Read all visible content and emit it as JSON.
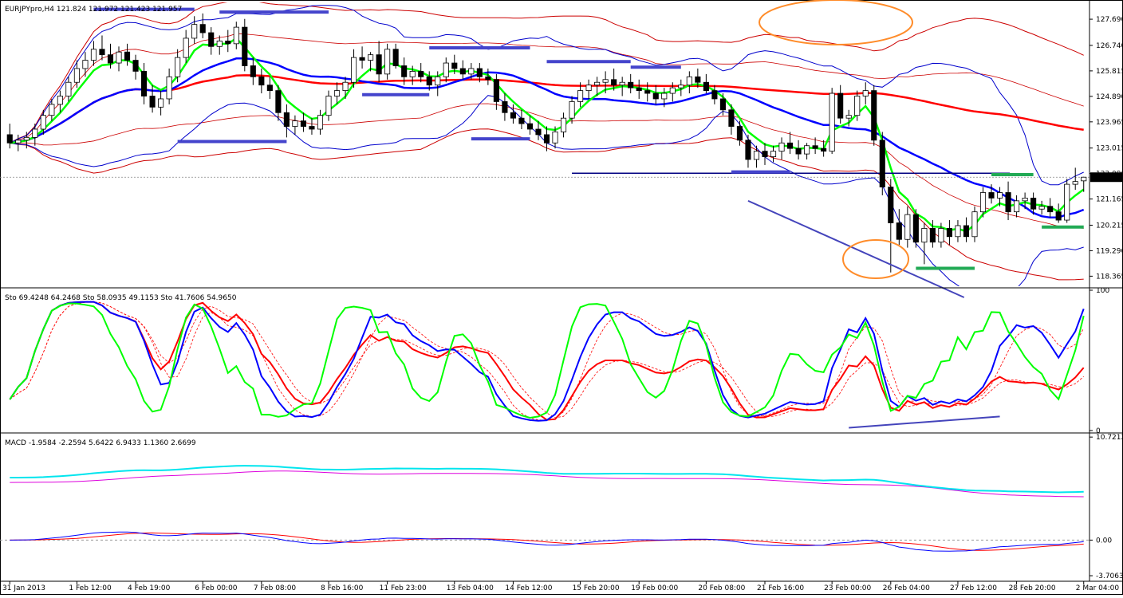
{
  "chart_data": [
    {
      "type": "candlestick",
      "panel": "price",
      "title": "EURJPYpro,H4  121.824 121.972 121.423 121.957",
      "y_ticks": [
        "127.690",
        "126.740",
        "125.815",
        "124.890",
        "123.965",
        "123.015",
        "122.090",
        "121.165",
        "120.215",
        "119.290",
        "118.365"
      ],
      "y_range": [
        118.0,
        128.3
      ],
      "current_price_label": "121.957",
      "horizontal_line_level": 122.1,
      "candles_ohlc": [
        [
          123.5,
          123.9,
          123.0,
          123.2
        ],
        [
          123.2,
          123.5,
          122.9,
          123.3
        ],
        [
          123.3,
          123.6,
          123.0,
          123.4
        ],
        [
          123.4,
          123.9,
          123.1,
          123.7
        ],
        [
          123.7,
          124.4,
          123.5,
          124.2
        ],
        [
          124.2,
          124.8,
          124.0,
          124.6
        ],
        [
          124.6,
          125.1,
          124.3,
          124.9
        ],
        [
          124.9,
          125.6,
          124.7,
          125.4
        ],
        [
          125.4,
          126.2,
          125.2,
          125.9
        ],
        [
          125.9,
          126.5,
          125.6,
          126.2
        ],
        [
          126.2,
          126.9,
          126.0,
          126.6
        ],
        [
          126.6,
          127.1,
          126.2,
          126.4
        ],
        [
          126.4,
          126.8,
          125.9,
          126.1
        ],
        [
          126.1,
          126.7,
          125.8,
          126.5
        ],
        [
          126.5,
          126.8,
          126.0,
          126.2
        ],
        [
          126.2,
          126.4,
          125.5,
          125.8
        ],
        [
          125.8,
          126.1,
          124.6,
          124.9
        ],
        [
          124.9,
          125.3,
          124.3,
          124.5
        ],
        [
          124.5,
          125.1,
          124.2,
          124.8
        ],
        [
          124.8,
          125.9,
          124.6,
          125.6
        ],
        [
          125.6,
          126.6,
          125.4,
          126.3
        ],
        [
          126.3,
          127.3,
          126.1,
          127.0
        ],
        [
          127.0,
          127.8,
          126.8,
          127.5
        ],
        [
          127.5,
          127.9,
          127.0,
          127.2
        ],
        [
          127.2,
          127.4,
          126.4,
          126.7
        ],
        [
          126.7,
          127.1,
          126.4,
          126.9
        ],
        [
          126.9,
          127.3,
          126.5,
          126.8
        ],
        [
          126.8,
          127.6,
          126.6,
          127.4
        ],
        [
          127.4,
          127.7,
          125.8,
          126.0
        ],
        [
          126.0,
          126.3,
          125.3,
          125.6
        ],
        [
          125.6,
          125.9,
          125.0,
          125.3
        ],
        [
          125.3,
          125.6,
          124.8,
          125.1
        ],
        [
          125.1,
          125.3,
          124.0,
          124.3
        ],
        [
          124.3,
          124.6,
          123.4,
          123.8
        ],
        [
          123.8,
          124.2,
          123.5,
          124.0
        ],
        [
          124.0,
          124.3,
          123.6,
          123.8
        ],
        [
          123.8,
          124.1,
          123.5,
          123.7
        ],
        [
          123.7,
          124.4,
          123.5,
          124.2
        ],
        [
          124.2,
          125.1,
          124.0,
          124.9
        ],
        [
          124.9,
          125.4,
          124.6,
          125.1
        ],
        [
          125.1,
          125.6,
          124.8,
          125.4
        ],
        [
          125.4,
          126.6,
          125.2,
          126.3
        ],
        [
          126.3,
          126.7,
          125.9,
          126.2
        ],
        [
          126.2,
          126.5,
          125.8,
          126.4
        ],
        [
          126.4,
          126.9,
          125.4,
          125.7
        ],
        [
          125.7,
          126.8,
          125.5,
          126.6
        ],
        [
          126.6,
          126.8,
          125.9,
          126.0
        ],
        [
          126.0,
          126.3,
          125.3,
          125.6
        ],
        [
          125.6,
          126.0,
          125.3,
          125.8
        ],
        [
          125.8,
          126.1,
          125.4,
          125.6
        ],
        [
          125.6,
          125.8,
          125.1,
          125.3
        ],
        [
          125.3,
          125.8,
          124.9,
          125.6
        ],
        [
          125.6,
          126.3,
          125.4,
          126.1
        ],
        [
          126.1,
          126.4,
          125.7,
          125.9
        ],
        [
          125.9,
          126.2,
          125.5,
          125.7
        ],
        [
          125.7,
          126.1,
          125.5,
          125.9
        ],
        [
          125.9,
          126.1,
          125.4,
          125.6
        ],
        [
          125.6,
          125.9,
          125.3,
          125.5
        ],
        [
          125.5,
          125.7,
          124.4,
          124.7
        ],
        [
          124.7,
          125.0,
          124.0,
          124.3
        ],
        [
          124.3,
          124.6,
          123.9,
          124.1
        ],
        [
          124.1,
          124.4,
          123.7,
          123.9
        ],
        [
          123.9,
          124.2,
          123.5,
          123.7
        ],
        [
          123.7,
          124.0,
          123.3,
          123.5
        ],
        [
          123.5,
          123.8,
          122.9,
          123.2
        ],
        [
          123.2,
          123.8,
          123.0,
          123.6
        ],
        [
          123.6,
          124.3,
          123.4,
          124.1
        ],
        [
          124.1,
          124.9,
          123.9,
          124.7
        ],
        [
          124.7,
          125.4,
          124.5,
          125.1
        ],
        [
          125.1,
          125.5,
          124.8,
          125.3
        ],
        [
          125.3,
          125.6,
          124.9,
          125.4
        ],
        [
          125.4,
          125.8,
          125.0,
          125.5
        ],
        [
          125.5,
          125.9,
          125.1,
          125.3
        ],
        [
          125.3,
          125.6,
          124.9,
          125.4
        ],
        [
          125.4,
          125.7,
          125.0,
          125.2
        ],
        [
          125.2,
          125.5,
          124.8,
          125.1
        ],
        [
          125.1,
          125.4,
          124.7,
          125.0
        ],
        [
          125.0,
          125.3,
          124.6,
          124.8
        ],
        [
          124.8,
          125.2,
          124.5,
          125.0
        ],
        [
          125.0,
          125.4,
          124.7,
          125.2
        ],
        [
          125.2,
          125.5,
          124.9,
          125.3
        ],
        [
          125.3,
          125.8,
          125.0,
          125.6
        ],
        [
          125.6,
          125.9,
          125.2,
          125.4
        ],
        [
          125.4,
          125.7,
          125.0,
          125.1
        ],
        [
          125.1,
          125.3,
          124.6,
          124.8
        ],
        [
          124.8,
          125.0,
          124.2,
          124.4
        ],
        [
          124.4,
          124.6,
          123.5,
          123.8
        ],
        [
          123.8,
          124.0,
          123.1,
          123.3
        ],
        [
          123.3,
          123.5,
          122.3,
          122.6
        ],
        [
          122.6,
          123.1,
          122.3,
          122.9
        ],
        [
          122.9,
          123.2,
          122.4,
          122.7
        ],
        [
          122.7,
          123.1,
          122.5,
          122.9
        ],
        [
          122.9,
          123.4,
          122.6,
          123.2
        ],
        [
          123.2,
          123.6,
          122.8,
          123.0
        ],
        [
          123.0,
          123.3,
          122.6,
          122.8
        ],
        [
          122.8,
          123.2,
          122.6,
          123.1
        ],
        [
          123.1,
          123.4,
          122.8,
          123.0
        ],
        [
          123.0,
          123.3,
          122.7,
          122.9
        ],
        [
          122.9,
          125.2,
          122.8,
          125.0
        ],
        [
          125.0,
          125.3,
          123.9,
          124.1
        ],
        [
          124.1,
          124.4,
          123.8,
          124.2
        ],
        [
          124.2,
          125.1,
          124.0,
          124.9
        ],
        [
          124.9,
          125.4,
          124.6,
          125.1
        ],
        [
          125.1,
          125.3,
          123.1,
          123.3
        ],
        [
          123.3,
          123.6,
          121.3,
          121.6
        ],
        [
          121.6,
          121.9,
          118.5,
          120.3
        ],
        [
          120.3,
          120.8,
          119.5,
          119.7
        ],
        [
          119.7,
          120.9,
          119.4,
          120.6
        ],
        [
          120.6,
          120.8,
          119.4,
          119.6
        ],
        [
          119.6,
          120.3,
          118.8,
          120.1
        ],
        [
          120.1,
          120.4,
          119.4,
          119.6
        ],
        [
          119.6,
          120.3,
          119.4,
          120.1
        ],
        [
          120.1,
          120.4,
          119.5,
          119.8
        ],
        [
          119.8,
          120.4,
          119.6,
          120.2
        ],
        [
          120.2,
          120.5,
          119.6,
          119.8
        ],
        [
          119.8,
          120.9,
          119.6,
          120.7
        ],
        [
          120.7,
          121.6,
          120.5,
          121.4
        ],
        [
          121.4,
          121.7,
          121.0,
          121.2
        ],
        [
          121.2,
          121.6,
          120.9,
          121.4
        ],
        [
          121.4,
          121.8,
          120.4,
          120.7
        ],
        [
          120.7,
          121.3,
          120.5,
          121.1
        ],
        [
          121.1,
          121.4,
          120.8,
          121.2
        ],
        [
          121.2,
          121.4,
          120.6,
          120.8
        ],
        [
          120.8,
          121.1,
          120.6,
          120.9
        ],
        [
          120.9,
          121.2,
          120.5,
          120.7
        ],
        [
          120.7,
          121.0,
          120.3,
          120.4
        ],
        [
          120.4,
          121.9,
          120.3,
          121.7
        ],
        [
          121.7,
          122.3,
          121.5,
          121.8
        ],
        [
          121.824,
          121.972,
          121.423,
          121.957
        ]
      ]
    },
    {
      "type": "line",
      "panel": "stochastic",
      "label": "Sto 69.4248 64.2468  Sto 58.0935 49.1153  Sto 41.7606 54.9650",
      "y_ticks": [
        "100",
        "0"
      ],
      "y_range": [
        0,
        100
      ]
    },
    {
      "type": "line",
      "panel": "macd",
      "label": "MACD -1.9584 -2.2594 5.6422 6.9433 1.1360 2.6699",
      "y_ticks": [
        "10.7212",
        "0.00",
        "-3.7063"
      ],
      "y_range": [
        -4.2,
        10.9
      ]
    }
  ],
  "x_ticks": [
    "31 Jan 2013",
    "1 Feb 12:00",
    "4 Feb 19:00",
    "6 Feb 00:00",
    "7 Feb 08:00",
    "8 Feb 16:00",
    "11 Feb 23:00",
    "13 Feb 04:00",
    "14 Feb 12:00",
    "15 Feb 20:00",
    "19 Feb 00:00",
    "20 Feb 08:00",
    "21 Feb 16:00",
    "23 Feb 00:00",
    "26 Feb 04:00",
    "27 Feb 12:00",
    "28 Feb 20:00",
    "2 Mar 04:00"
  ],
  "colors": {
    "candle_up": "#ffffff",
    "candle_down": "#000000",
    "ema_green": "#00ff00",
    "ma_blue": "#0000ff",
    "ma_red": "#ff0000",
    "band_red": "#cc0000",
    "band_blue": "#0000cc",
    "level_marker_blue": "#4444cc",
    "level_marker_green": "#22aa55",
    "ellipse_orange": "#ff8c2a",
    "macd_cyan": "#00e5ee",
    "macd_magenta": "#dd00dd"
  }
}
